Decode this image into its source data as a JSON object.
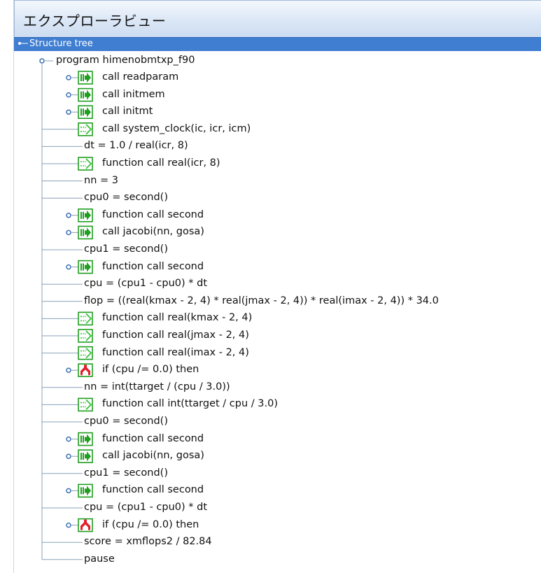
{
  "panel": {
    "title": "エクスプローラビュー"
  },
  "tree": {
    "root_label": "Structure tree",
    "program_label": "program himenobmtxp_f90",
    "items": [
      {
        "label": "call readparam",
        "icon": "call-arrow-icon",
        "expander": true
      },
      {
        "label": "call initmem",
        "icon": "call-arrow-icon",
        "expander": true
      },
      {
        "label": "call initmt",
        "icon": "call-arrow-icon",
        "expander": true
      },
      {
        "label": "call system_clock(ic, icr, icm)",
        "icon": "external-call-icon",
        "expander": false
      },
      {
        "label": "dt = 1.0 / real(icr, 8)",
        "icon": "",
        "expander": false
      },
      {
        "label": "function call real(icr, 8)",
        "icon": "external-call-icon",
        "expander": false
      },
      {
        "label": "nn = 3",
        "icon": "",
        "expander": false
      },
      {
        "label": "cpu0 = second()",
        "icon": "",
        "expander": false
      },
      {
        "label": "function call second",
        "icon": "call-arrow-icon",
        "expander": true
      },
      {
        "label": "call jacobi(nn, gosa)",
        "icon": "call-arrow-icon",
        "expander": true
      },
      {
        "label": "cpu1 = second()",
        "icon": "",
        "expander": false
      },
      {
        "label": "function call second",
        "icon": "call-arrow-icon",
        "expander": true
      },
      {
        "label": "cpu = (cpu1 - cpu0) * dt",
        "icon": "",
        "expander": false
      },
      {
        "label": "flop = ((real(kmax - 2, 4) * real(jmax - 2, 4)) * real(imax - 2, 4)) * 34.0",
        "icon": "",
        "expander": false
      },
      {
        "label": "function call real(kmax - 2, 4)",
        "icon": "external-call-icon",
        "expander": false
      },
      {
        "label": "function call real(jmax - 2, 4)",
        "icon": "external-call-icon",
        "expander": false
      },
      {
        "label": "function call real(imax - 2, 4)",
        "icon": "external-call-icon",
        "expander": false
      },
      {
        "label": "if (cpu /= 0.0) then",
        "icon": "if-branch-icon",
        "expander": true
      },
      {
        "label": "nn = int(ttarget / (cpu / 3.0))",
        "icon": "",
        "expander": false
      },
      {
        "label": "function call int(ttarget / cpu / 3.0)",
        "icon": "external-call-icon",
        "expander": false
      },
      {
        "label": "cpu0 = second()",
        "icon": "",
        "expander": false
      },
      {
        "label": "function call second",
        "icon": "call-arrow-icon",
        "expander": true
      },
      {
        "label": "call jacobi(nn, gosa)",
        "icon": "call-arrow-icon",
        "expander": true
      },
      {
        "label": "cpu1 = second()",
        "icon": "",
        "expander": false
      },
      {
        "label": "function call second",
        "icon": "call-arrow-icon",
        "expander": true
      },
      {
        "label": "cpu = (cpu1 - cpu0) * dt",
        "icon": "",
        "expander": false
      },
      {
        "label": "if (cpu /= 0.0) then",
        "icon": "if-branch-icon",
        "expander": true
      },
      {
        "label": "score = xmflops2 / 82.84",
        "icon": "",
        "expander": false
      },
      {
        "label": "pause",
        "icon": "",
        "expander": false
      }
    ]
  },
  "colors": {
    "root_row_bg": "#3f7ed1",
    "tree_line": "#8aa0b8",
    "call_icon_green": "#1f9e1f",
    "external_call_green": "#3cbf3c",
    "if_icon_red": "#e0202c"
  }
}
